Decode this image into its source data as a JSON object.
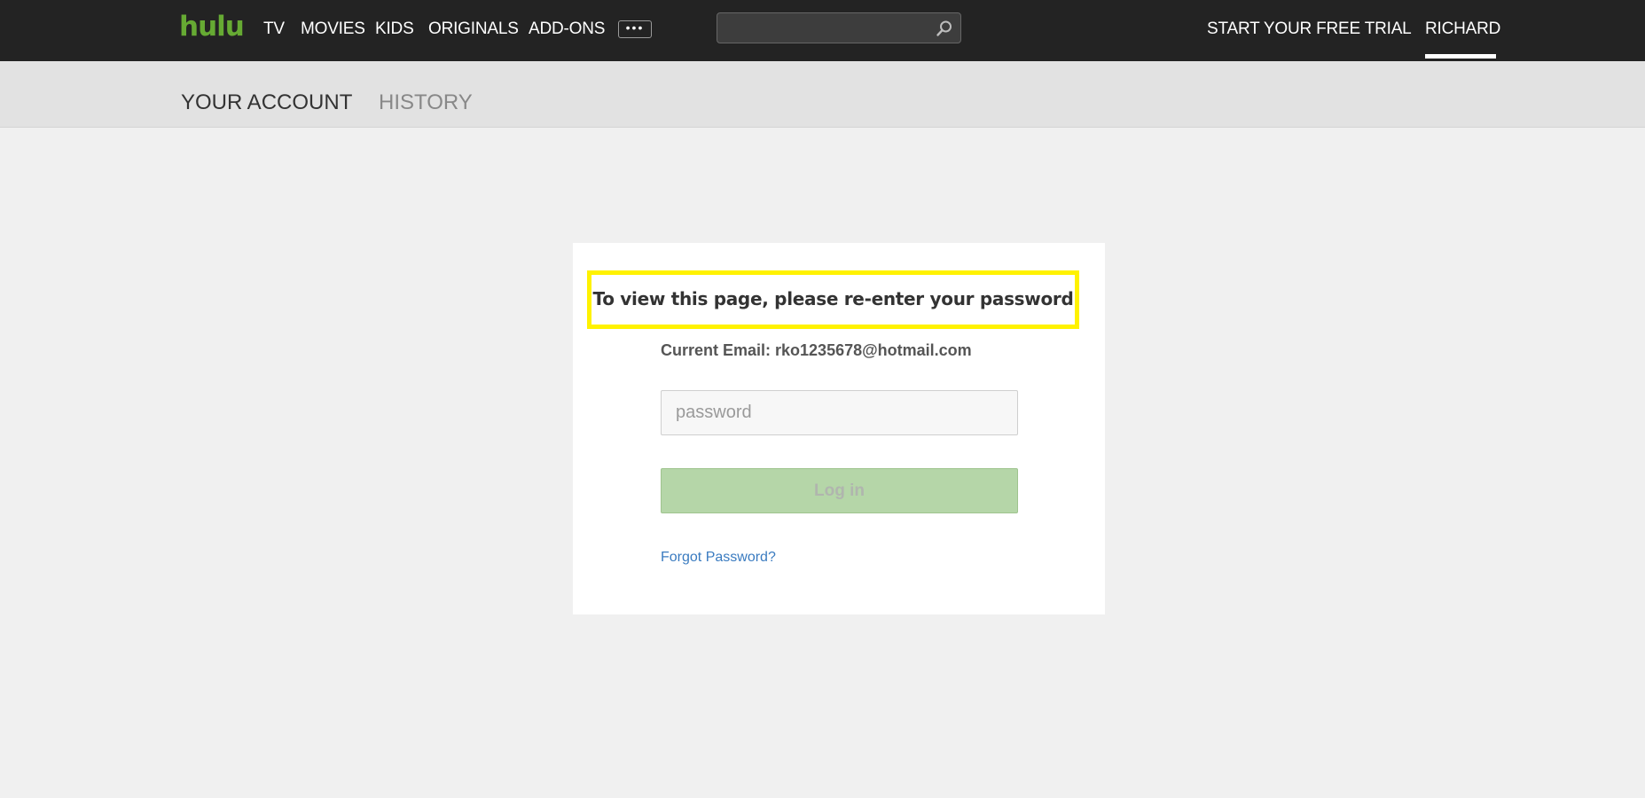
{
  "header": {
    "logo": "hulu",
    "nav": [
      {
        "label": "TV"
      },
      {
        "label": "MOVIES"
      },
      {
        "label": "KIDS"
      },
      {
        "label": "ORIGINALS"
      },
      {
        "label": "ADD-ONS"
      }
    ],
    "more_label": "•••",
    "search": {
      "value": "",
      "placeholder": ""
    },
    "trial_label": "START YOUR FREE TRIAL",
    "user_label": "RICHARD"
  },
  "subnav": {
    "account_label": "YOUR ACCOUNT",
    "history_label": "HISTORY"
  },
  "card": {
    "title": "To view this page, please re-enter your password",
    "email_line": "Current Email: rko1235678@hotmail.com",
    "password_placeholder": "password",
    "login_label": "Log in",
    "forgot_label": "Forgot Password?"
  },
  "colors": {
    "brand": "#66aa33",
    "topbar": "#232323",
    "highlight": "#fff200",
    "login_button": "#b5d6a8",
    "link": "#3a7bc0"
  }
}
